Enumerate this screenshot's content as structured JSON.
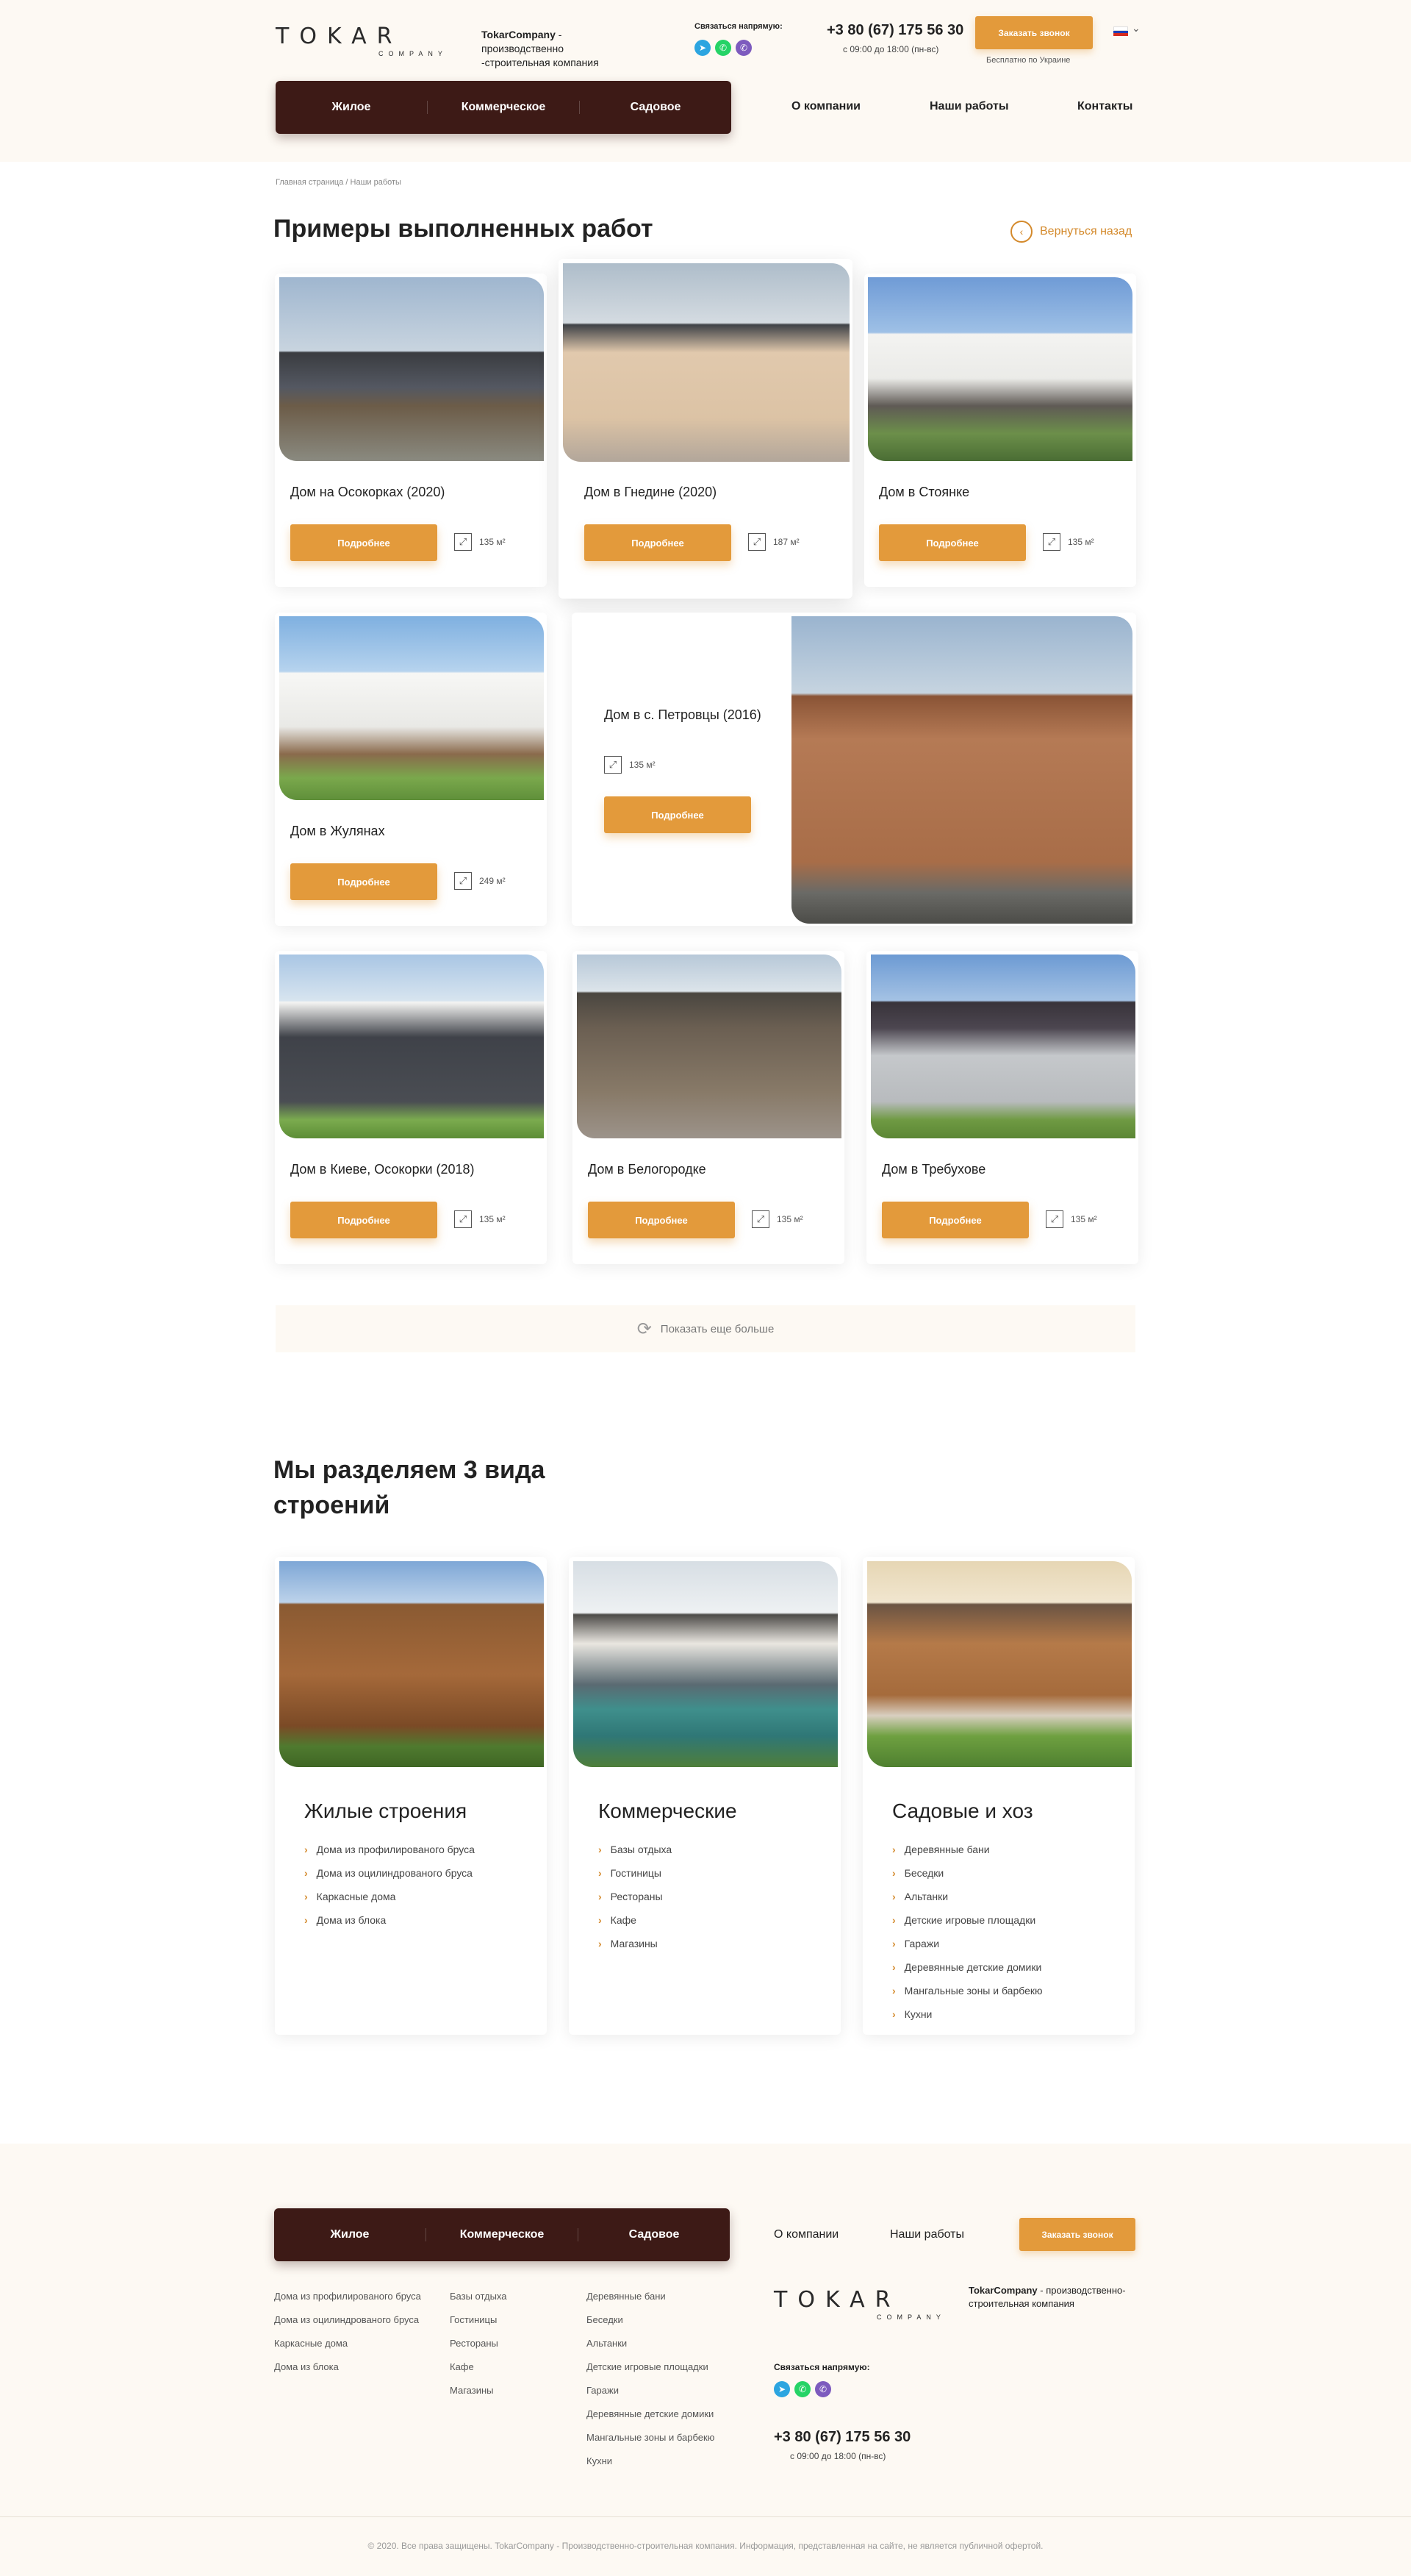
{
  "header": {
    "logo_main": "TOKAR",
    "logo_sub": "COMPANY",
    "tagline_brand": "TokarCompany",
    "tagline_rest": " - производственно -строительная компания",
    "contact_label": "Связаться напрямую:",
    "phone": "+3 80 (67) 175 56 30",
    "hours": "с 09:00 до 18:00 (пн-вс)",
    "call_button": "Заказать звонок",
    "free_note": "Бесплатно по Украине",
    "lang_chevron": "⌄"
  },
  "nav": {
    "dark": [
      "Жилое",
      "Коммерческое",
      "Садовое"
    ],
    "links": [
      "О компании",
      "Наши работы",
      "Контакты"
    ]
  },
  "breadcrumb": "Главная страница / Наши работы",
  "page_title": "Примеры выполненных работ",
  "back_label": "Вернуться назад",
  "details_label": "Подробнее",
  "works": [
    {
      "title": "Дом на Осокорках (2020)",
      "area": "135 м²"
    },
    {
      "title": "Дом в Гнедине (2020)",
      "area": "187 м²"
    },
    {
      "title": "Дом в Стоянке",
      "area": "135 м²"
    },
    {
      "title": "Дом в Жулянах",
      "area": "249 м²"
    },
    {
      "title": "Дом в с. Петровцы (2016)",
      "area": "135 м²"
    },
    {
      "title": "Дом в Киеве, Осокорки (2018)",
      "area": "135 м²"
    },
    {
      "title": "Дом в Белогородке",
      "area": "135 м²"
    },
    {
      "title": "Дом в Требухове",
      "area": "135 м²"
    }
  ],
  "show_more": "Показать еще больше",
  "types_title": "Мы разделяем 3 вида строений",
  "types": [
    {
      "title": "Жилые строения",
      "items": [
        "Дома из профилированого бруса",
        "Дома из оцилиндрованого бруса",
        "Каркасные дома",
        "Дома из блока"
      ]
    },
    {
      "title": "Коммерческие",
      "items": [
        "Базы отдыха",
        "Гостиницы",
        "Рестораны",
        "Кафе",
        "Магазины"
      ]
    },
    {
      "title": "Садовые и хоз",
      "items": [
        "Деревянные бани",
        "Беседки",
        "Альтанки",
        "Детские игровые площадки",
        "Гаражи",
        "Деревянные детские домики",
        "Мангальные зоны и барбекю",
        "Кухни"
      ]
    }
  ],
  "footer": {
    "nav_dark": [
      "Жилое",
      "Коммерческое",
      "Садовое"
    ],
    "links": [
      "О компании",
      "Наши работы"
    ],
    "call_button": "Заказать звонок",
    "col1": [
      "Дома из профилированого бруса",
      "Дома из оцилиндрованого бруса",
      "Каркасные дома",
      "Дома из блока"
    ],
    "col2": [
      "Базы отдыха",
      "Гостиницы",
      "Рестораны",
      "Кафе",
      "Магазины"
    ],
    "col3": [
      "Деревянные бани",
      "Беседки",
      "Альтанки",
      "Детские игровые площадки",
      "Гаражи",
      "Деревянные детские домики",
      "Мангальные зоны и барбекю",
      "Кухни"
    ],
    "tagline_brand": "TokarCompany",
    "tagline_rest": " - производственно-строительная компания",
    "contact_label": "Связаться напрямую:",
    "phone": "+3 80 (67) 175 56 30",
    "hours": "с 09:00 до 18:00 (пн-вс)",
    "copyright": "© 2020. Все права защищены. TokarCompany - Производственно-строительная компания. Информация, представленная на сайте, не является публичной офертой."
  },
  "colors": {
    "accent": "#e39a3b",
    "dark": "#3d1a16",
    "cream": "#fdf9f3"
  },
  "icons": {
    "telegram": "telegram-icon",
    "whatsapp": "whatsapp-icon",
    "viber": "viber-icon",
    "area": "area-expand-icon",
    "refresh": "refresh-icon",
    "back": "arrow-left-icon",
    "bullet": "chevron-right-icon"
  }
}
